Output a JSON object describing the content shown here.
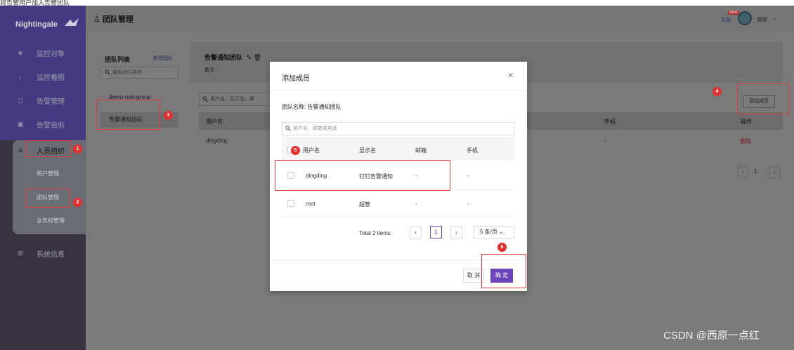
{
  "caption": "将告警用户加入告警团队",
  "sidebar": {
    "brand": "Nightingale",
    "menu": [
      {
        "label": "监控对象",
        "icon": "target-icon"
      },
      {
        "label": "监控看图",
        "icon": "chart-icon"
      },
      {
        "label": "告警管理",
        "icon": "bell-icon"
      },
      {
        "label": "告警自愈",
        "icon": "heal-icon"
      },
      {
        "label": "人员组织",
        "icon": "user-icon"
      },
      {
        "label": "系统信息",
        "icon": "grid-icon"
      }
    ],
    "submenu": [
      "用户管理",
      "团队管理",
      "业务组管理"
    ]
  },
  "header": {
    "title": "团队管理",
    "docs": "文档",
    "new_badge": "NEW",
    "user": "超管"
  },
  "team_list": {
    "title": "团队列表",
    "new_link": "新建团队",
    "search_placeholder": "搜索团队名称",
    "items": [
      "demo-root-group",
      "告警通知团队"
    ]
  },
  "detail": {
    "title": "告警通知团队",
    "remark": "备注: -",
    "search_placeholder": "用户名、显示名、邮",
    "add_member": "添加成员",
    "columns": {
      "username": "用户名",
      "phone": "手机",
      "action": "操作"
    },
    "row": {
      "username": "dingding",
      "phone": "-",
      "delete": "删除"
    },
    "pager_current": "1"
  },
  "modal": {
    "title": "添加成员",
    "team_label": "团队名称: 告警通知团队",
    "search_placeholder": "用户名、邮箱或电话",
    "columns": [
      "用户名",
      "显示名",
      "邮箱",
      "手机"
    ],
    "rows": [
      {
        "username": "dingding",
        "display": "钉钉告警通知",
        "email": "-",
        "phone": "-"
      },
      {
        "username": "root",
        "display": "超管",
        "email": "-",
        "phone": "-"
      }
    ],
    "total": "Total 2 items",
    "page": "1",
    "page_size": "5 条/页",
    "cancel": "取 消",
    "ok": "确 定"
  },
  "annotations": [
    "1",
    "2",
    "3",
    "4",
    "5",
    "6"
  ],
  "watermark": "CSDN @西原一点红",
  "colors": {
    "sidebar": "#37333f",
    "sidebar_active": "#453a82",
    "primary": "#6b45b7",
    "annotation": "#e03030"
  }
}
